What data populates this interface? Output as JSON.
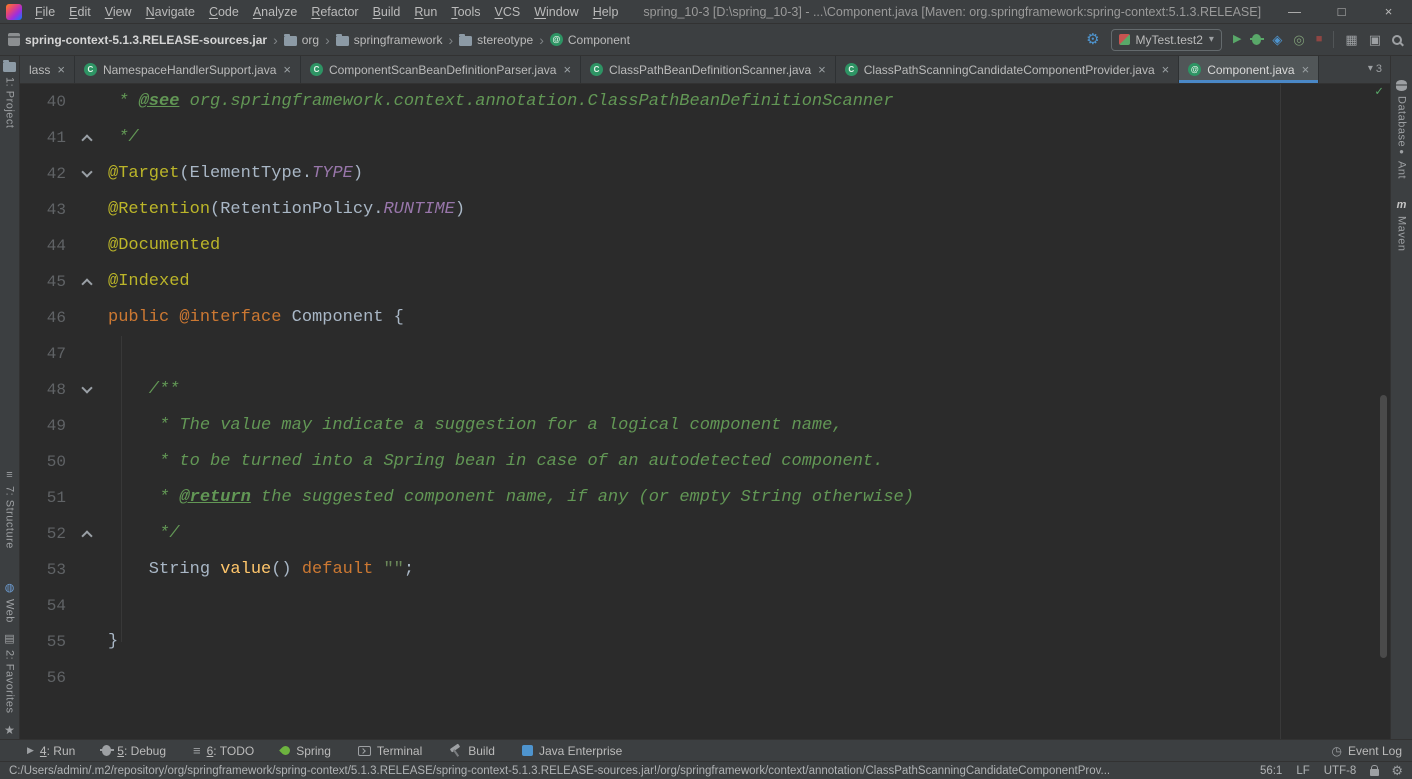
{
  "colors": {
    "accent_blue": "#4A88C7",
    "chrome_bg": "#3c3f41",
    "editor_bg": "#2b2b2b",
    "run_green": "#59A869",
    "stop_red": "#8f4643",
    "annotation_yellow": "#BBB529",
    "keyword_orange": "#CC7832",
    "comment_green": "#629755"
  },
  "titlebar": {
    "menus": [
      "File",
      "Edit",
      "View",
      "Navigate",
      "Code",
      "Analyze",
      "Refactor",
      "Build",
      "Run",
      "Tools",
      "VCS",
      "Window",
      "Help"
    ],
    "title": "spring_10-3 [D:\\spring_10-3] - ...\\Component.java [Maven: org.springframework:spring-context:5.1.3.RELEASE]",
    "controls": {
      "minimize": "—",
      "maximize": "□",
      "close": "×"
    }
  },
  "navbar": {
    "breadcrumbs": [
      {
        "label": "spring-context-5.1.3.RELEASE-sources.jar",
        "icon": "jar-icon",
        "bold": true
      },
      {
        "label": "org",
        "icon": "folder-icon"
      },
      {
        "label": "springframework",
        "icon": "folder-icon"
      },
      {
        "label": "stereotype",
        "icon": "folder-icon"
      },
      {
        "label": "Component",
        "icon": "annotation-icon"
      }
    ],
    "left_actions": [
      "wrench-icon"
    ],
    "run_config": {
      "icon": "junit-icon",
      "label": "MyTest.test2"
    },
    "run_actions": [
      "play-icon",
      "debug-icon",
      "coverage-icon",
      "profiler-icon",
      "stop-icon"
    ],
    "right_actions": [
      "tool-windows-icon",
      "layout-icon",
      "search-icon"
    ]
  },
  "tabs": {
    "items": [
      {
        "label": "lass",
        "icon": null
      },
      {
        "label": "NamespaceHandlerSupport.java",
        "icon": "class-icon"
      },
      {
        "label": "ComponentScanBeanDefinitionParser.java",
        "icon": "class-icon"
      },
      {
        "label": "ClassPathBeanDefinitionScanner.java",
        "icon": "class-icon"
      },
      {
        "label": "ClassPathScanningCandidateComponentProvider.java",
        "icon": "class-icon"
      },
      {
        "label": "Component.java",
        "icon": "annotation-icon",
        "active": true
      }
    ],
    "more_count": "3"
  },
  "stripes": {
    "left": [
      {
        "label": "1: Project",
        "icon": "project-icon"
      },
      {
        "label": "7: Structure",
        "icon": "structure-icon"
      },
      {
        "label": "Web",
        "icon": "web-icon"
      },
      {
        "label": "2: Favorites",
        "icon": "favorites-icon"
      }
    ],
    "left_bottom": {
      "icon": "star-icon"
    },
    "right": [
      {
        "label": "Database",
        "icon": "database-icon"
      },
      {
        "label": "Ant",
        "icon": "ant-icon"
      },
      {
        "label": "Maven",
        "icon": "maven-icon"
      }
    ]
  },
  "editor": {
    "inspection": "ok",
    "lines": [
      {
        "n": 40,
        "tokens": [
          [
            "com",
            " * "
          ],
          [
            "tag",
            "@see"
          ],
          [
            "com",
            " org.springframework.context.annotation.ClassPathBeanDefinitionScanner"
          ]
        ]
      },
      {
        "n": 41,
        "fold": "up",
        "tokens": [
          [
            "com",
            " */"
          ]
        ]
      },
      {
        "n": 42,
        "fold": "down",
        "tokens": [
          [
            "ann",
            "@Target"
          ],
          [
            "pln",
            "(ElementType."
          ],
          [
            "cst",
            "TYPE"
          ],
          [
            "pln",
            ")"
          ]
        ]
      },
      {
        "n": 43,
        "tokens": [
          [
            "ann",
            "@Retention"
          ],
          [
            "pln",
            "(RetentionPolicy."
          ],
          [
            "cst",
            "RUNTIME"
          ],
          [
            "pln",
            ")"
          ]
        ]
      },
      {
        "n": 44,
        "tokens": [
          [
            "ann",
            "@Documented"
          ]
        ]
      },
      {
        "n": 45,
        "fold": "up",
        "tokens": [
          [
            "ann",
            "@Indexed"
          ]
        ]
      },
      {
        "n": 46,
        "tokens": [
          [
            "kw",
            "public "
          ],
          [
            "kw",
            "@interface"
          ],
          [
            "pln",
            " Component {"
          ]
        ]
      },
      {
        "n": 47,
        "tokens": []
      },
      {
        "n": 48,
        "fold": "down",
        "tokens": [
          [
            "com",
            "    /**"
          ]
        ]
      },
      {
        "n": 49,
        "tokens": [
          [
            "com",
            "     * The value may indicate a suggestion for a logical component name,"
          ]
        ]
      },
      {
        "n": 50,
        "tokens": [
          [
            "com",
            "     * to be turned into a Spring bean in case of an autodetected component."
          ]
        ]
      },
      {
        "n": 51,
        "tokens": [
          [
            "com",
            "     * "
          ],
          [
            "tag",
            "@return"
          ],
          [
            "com",
            " the suggested component name, if any (or empty String otherwise)"
          ]
        ]
      },
      {
        "n": 52,
        "fold": "up",
        "tokens": [
          [
            "com",
            "     */"
          ]
        ]
      },
      {
        "n": 53,
        "tokens": [
          [
            "pln",
            "    String "
          ],
          [
            "mth",
            "value"
          ],
          [
            "pln",
            "() "
          ],
          [
            "kw",
            "default "
          ],
          [
            "str",
            "\"\""
          ],
          [
            "pln",
            ";"
          ]
        ]
      },
      {
        "n": 54,
        "tokens": []
      },
      {
        "n": 55,
        "tokens": [
          [
            "pln",
            "}"
          ]
        ]
      },
      {
        "n": 56,
        "tokens": []
      }
    ]
  },
  "bottombar": {
    "items": [
      {
        "mnemonic": "4",
        "label": "Run",
        "icon": "run-icon"
      },
      {
        "mnemonic": "5",
        "label": "Debug",
        "icon": "debug-gray-icon"
      },
      {
        "mnemonic": "6",
        "label": "TODO",
        "icon": "todo-icon"
      },
      {
        "label": "Spring",
        "icon": "spring-icon"
      },
      {
        "label": "Terminal",
        "icon": "terminal-icon"
      },
      {
        "label": "Build",
        "icon": "build-icon"
      },
      {
        "label": "Java Enterprise",
        "icon": "javaee-icon"
      }
    ],
    "right": {
      "label": "Event Log",
      "icon": "event-log-icon"
    }
  },
  "statusbar": {
    "path": "C:/Users/admin/.m2/repository/org/springframework/spring-context/5.1.3.RELEASE/spring-context-5.1.3.RELEASE-sources.jar!/org/springframework/context/annotation/ClassPathScanningCandidateComponentProv...",
    "caret_position": "56:1",
    "line_separator": "LF",
    "encoding": "UTF-8",
    "icons": [
      "lock-icon",
      "gear-icon"
    ]
  }
}
